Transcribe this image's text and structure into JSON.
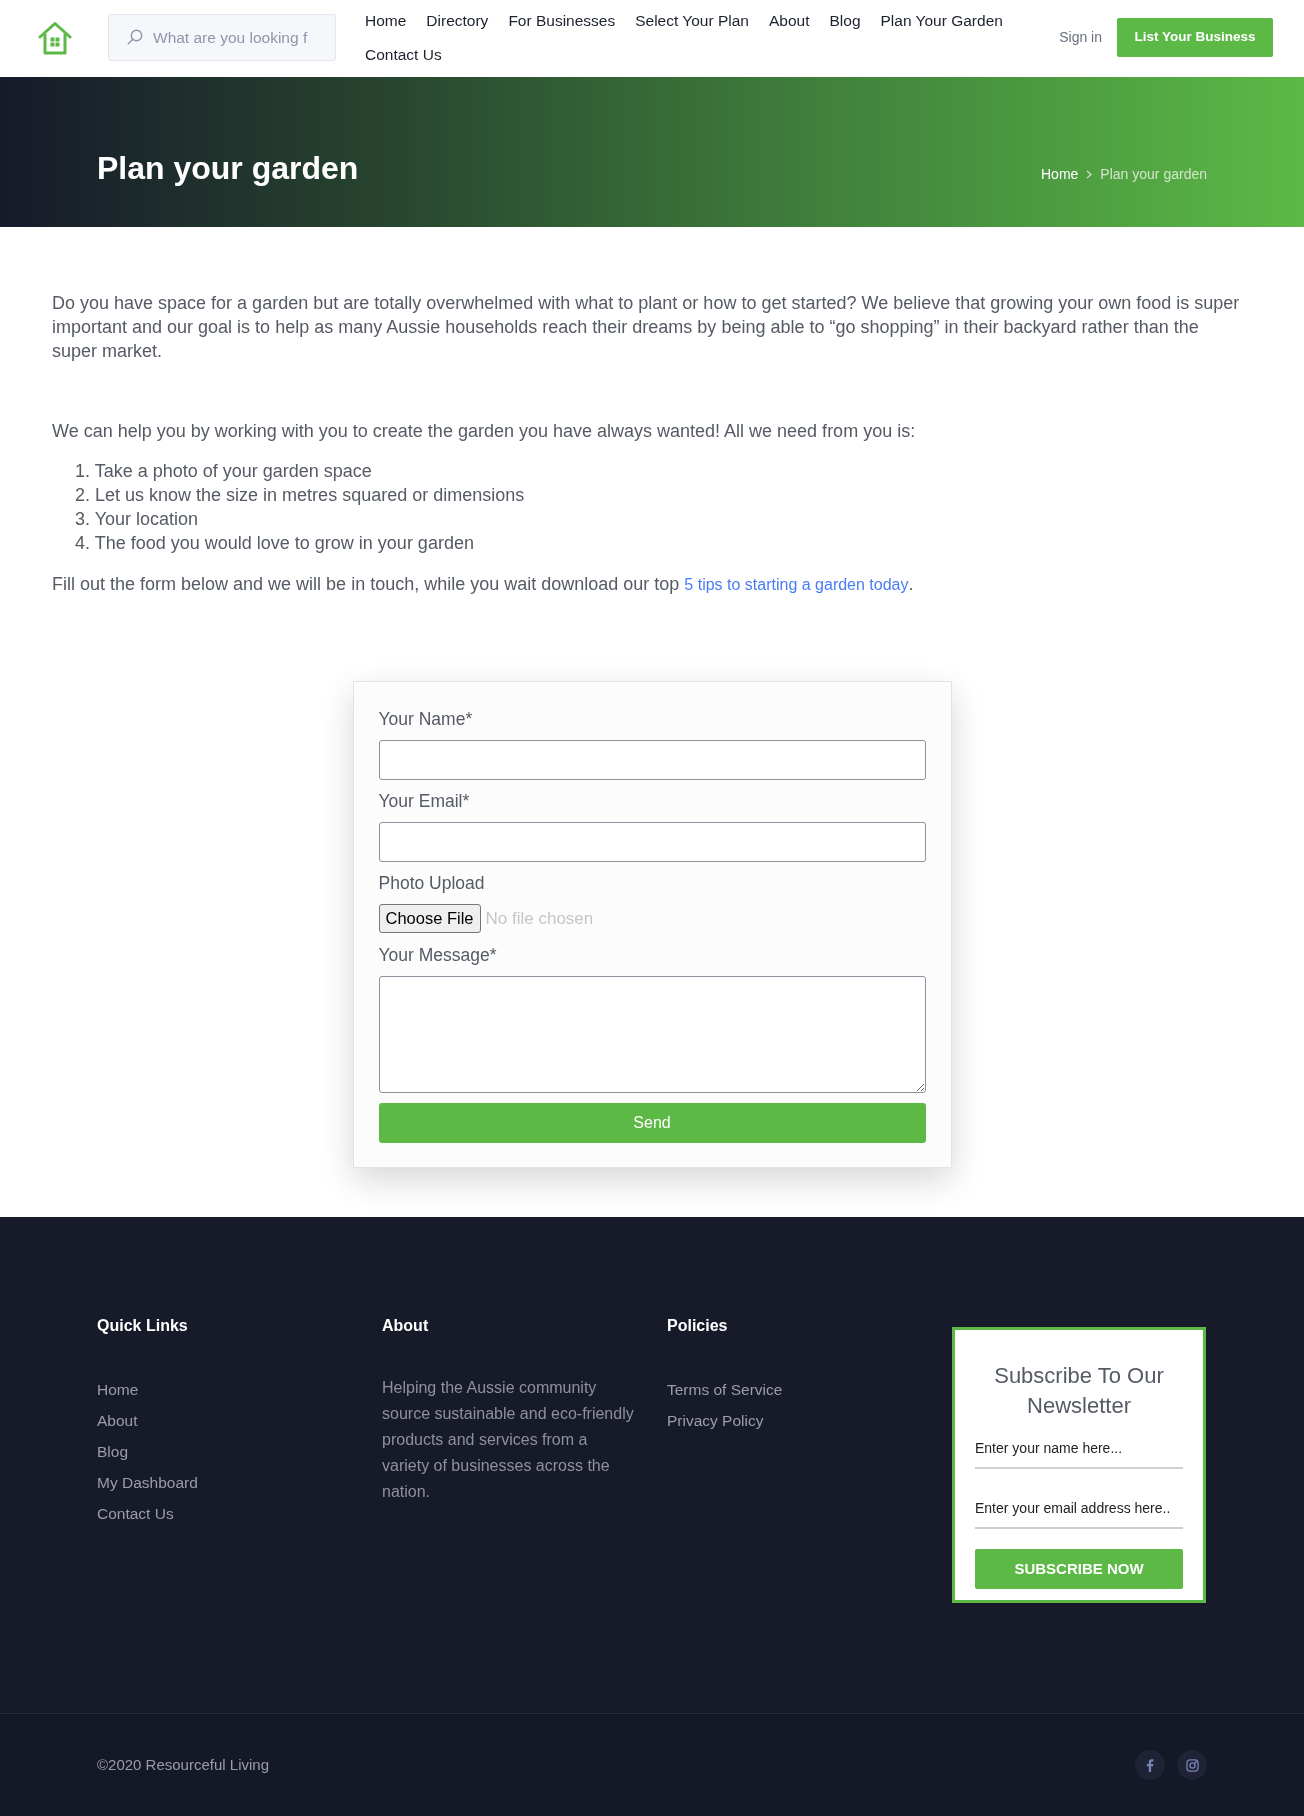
{
  "header": {
    "search": {
      "placeholder": "What are you looking f"
    },
    "nav": [
      "Home",
      "Directory",
      "For Businesses",
      "Select Your Plan",
      "About",
      "Blog",
      "Plan Your Garden",
      "Contact Us"
    ],
    "sign_in": "Sign in",
    "cta": "List Your Business"
  },
  "hero": {
    "title": "Plan your garden",
    "breadcrumb": [
      {
        "label": "Home",
        "current": false
      },
      {
        "label": "Plan your garden",
        "current": true
      }
    ]
  },
  "intro": {
    "paragraphs": [
      "Do you have space for a garden but are totally overwhelmed with what to plant or how to get started? We believe that growing your own food is super important and our goal is to help as many Aussie households reach their dreams by being able to “go shopping” in their backyard rather than the super market.",
      "We can help you by working with you to create the garden you have always wanted! All we need from you is:"
    ],
    "steps": [
      "1. Take a photo of your garden space",
      "2. Let us know the size in metres squared or dimensions",
      "3. Your location",
      "4. The food you would love to grow in your garden"
    ],
    "closing": {
      "text": "Fill out the form below and we will be in touch, while you wait download our top",
      "link": "5 tips to starting a garden today",
      "end": "."
    }
  },
  "form": {
    "fields": [
      {
        "kind": "text",
        "label": "Your Name*"
      },
      {
        "kind": "email",
        "label": "Your Email*"
      },
      {
        "kind": "file",
        "label": "Photo Upload",
        "button": "Choose File",
        "status": "No file chosen"
      },
      {
        "kind": "textarea",
        "label": "Your Message*"
      }
    ],
    "submit": "Send"
  },
  "footer": {
    "columns": [
      {
        "kind": "links",
        "heading": "Quick Links",
        "links": [
          "Home",
          "About",
          "Blog",
          "My Dashboard",
          "Contact Us"
        ]
      },
      {
        "kind": "text",
        "heading": "About",
        "text": "Helping the Aussie community source sustainable and eco-friendly products and services from a variety of businesses across the nation."
      },
      {
        "kind": "links",
        "heading": "Policies",
        "links": [
          "Terms of Service",
          "Privacy Policy"
        ]
      }
    ],
    "newsletter": {
      "title": "Subscribe To Our Newsletter",
      "fields": [
        {
          "placeholder": "Enter your name here..."
        },
        {
          "placeholder": "Enter your email address here.."
        }
      ],
      "button": "SUBSCRIBE NOW"
    },
    "copyright": "©2020 Resourceful Living"
  }
}
